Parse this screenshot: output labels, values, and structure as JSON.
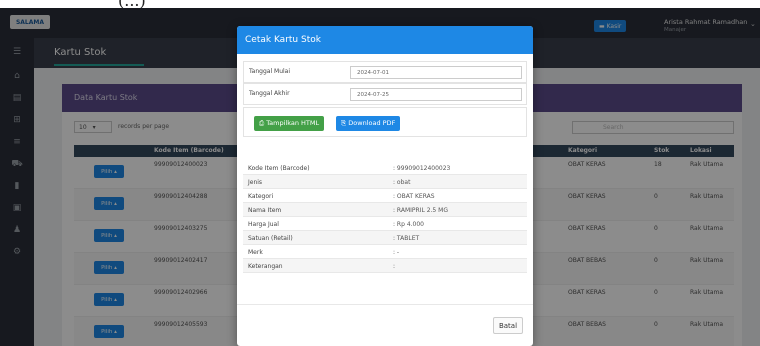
{
  "top_heading": "(...)",
  "header": {
    "logo_text": "SALAMA",
    "kasir_button": "▬ Kasir",
    "user_name": "Arista Rahmat Ramadhan",
    "user_role": "Manajer"
  },
  "sidebar": {
    "icons": [
      "menu-icon",
      "home-icon",
      "clipboard-icon",
      "box-icon",
      "list-icon",
      "cart-icon",
      "file-icon",
      "image-icon",
      "users-icon",
      "gear-icon"
    ]
  },
  "page": {
    "title": "Kartu Stok"
  },
  "card": {
    "title": "Data Kartu Stok",
    "length_value": "10",
    "length_label": "records per page",
    "search_placeholder": "Search"
  },
  "table": {
    "headers": [
      "Kode Item (Barcode)",
      "Kategori",
      "Stok",
      "Lokasi"
    ],
    "pilih_label": "Pilih ▴",
    "rows": [
      {
        "kode": "99909012400023",
        "kategori": "OBAT KERAS",
        "stok": "18",
        "lokasi": "Rak Utama"
      },
      {
        "kode": "99909012404288",
        "kategori": "OBAT KERAS",
        "stok": "0",
        "lokasi": "Rak Utama"
      },
      {
        "kode": "99909012403275",
        "kategori": "OBAT KERAS",
        "stok": "0",
        "lokasi": "Rak Utama"
      },
      {
        "kode": "99909012402417",
        "kategori": "OBAT BEBAS",
        "stok": "0",
        "lokasi": "Rak Utama"
      },
      {
        "kode": "99909012402966",
        "kategori": "OBAT KERAS",
        "stok": "0",
        "lokasi": "Rak Utama"
      },
      {
        "kode": "99909012405593",
        "kategori": "OBAT BEBAS",
        "stok": "0",
        "lokasi": "Rak Utama"
      }
    ]
  },
  "modal": {
    "title": "Cetak Kartu Stok",
    "tanggal_mulai_label": "Tanggal Mulai",
    "tanggal_mulai_value": "2024-07-01",
    "tanggal_akhir_label": "Tanggal Akhir",
    "tanggal_akhir_value": "2024-07-25",
    "btn_html": "⎙ Tampilkan HTML",
    "btn_pdf": "⎘ Download PDF",
    "details": [
      {
        "key": "Kode Item (Barcode)",
        "value": ": 99909012400023"
      },
      {
        "key": "Jenis",
        "value": ": obat"
      },
      {
        "key": "Kategori",
        "value": ": OBAT KERAS"
      },
      {
        "key": "Nama Item",
        "value": ": RAMIPRIL 2.5 MG"
      },
      {
        "key": "Harga Jual",
        "value": ": Rp 4.000"
      },
      {
        "key": "Satuan (Retail)",
        "value": ": TABLET"
      },
      {
        "key": "Merk",
        "value": ": -"
      },
      {
        "key": "Keterangan",
        "value": ":"
      }
    ],
    "btn_batal": "Batal"
  }
}
